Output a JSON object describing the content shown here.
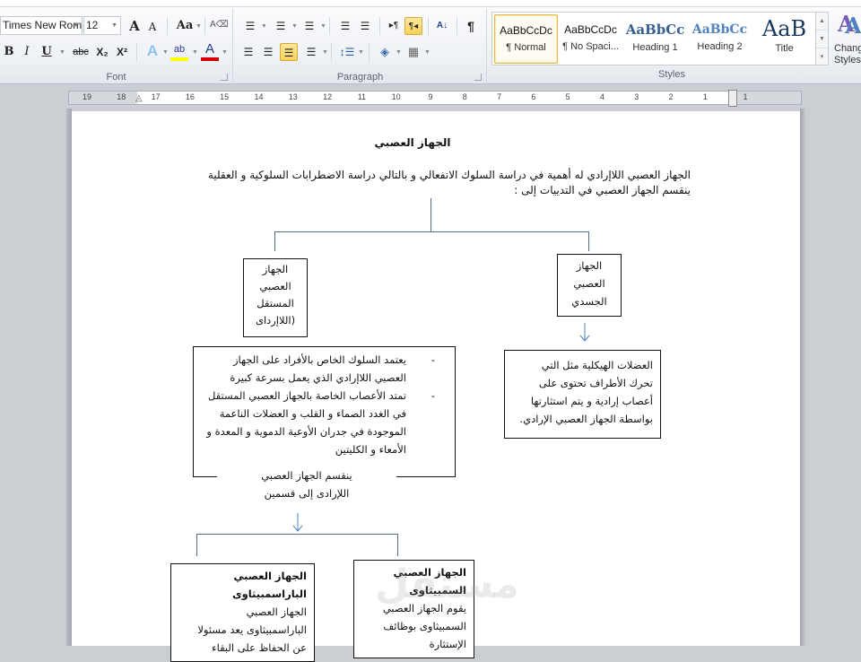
{
  "ribbon": {
    "font_group": {
      "label": "Font",
      "font_name": "Times New Rom",
      "font_size": "12",
      "grow_font": "A",
      "shrink_font": "A",
      "change_case": "Aa",
      "clear_format_icon": "clear-formatting",
      "bold": "B",
      "italic": "I",
      "underline": "U",
      "strikethrough": "abc",
      "subscript": "X₂",
      "superscript": "X²",
      "text_effects": "A",
      "highlight": "ab",
      "font_color": "A"
    },
    "paragraph_group": {
      "label": "Paragraph",
      "bullets": "☷",
      "numbering": "☷",
      "multilevel": "☷",
      "decrease_indent": "☰",
      "increase_indent": "☰",
      "ltr": "▸¶",
      "rtl": "¶◂",
      "sort": "A↓Z",
      "show_marks": "¶",
      "align_left": "☰",
      "center": "☰",
      "align_right": "☰",
      "justify": "☰",
      "line_spacing": "↕☰",
      "shading": "◈",
      "borders": "▦"
    },
    "styles_group": {
      "label": "Styles",
      "items": [
        {
          "preview": "AaBbCcDc",
          "name": "¶ Normal",
          "selected": true
        },
        {
          "preview": "AaBbCcDc",
          "name": "¶ No Spaci...",
          "selected": false
        },
        {
          "preview": "AaBbCc",
          "name": "Heading 1",
          "selected": false
        },
        {
          "preview": "AaBbCc",
          "name": "Heading 2",
          "selected": false
        },
        {
          "preview": "AaB",
          "name": "Title",
          "selected": false
        }
      ],
      "change_styles": "Change Styles",
      "change_styles_line1": "Chang",
      "change_styles_line2": "Styles"
    },
    "accent_colors": {
      "active_button": "#f9d25a",
      "highlight_bar": "#ffff00",
      "font_color_bar": "#d40000",
      "connector": "#4f6e8a"
    }
  },
  "ruler": {
    "numbers": [
      "19",
      "18",
      "17",
      "16",
      "15",
      "14",
      "13",
      "12",
      "11",
      "10",
      "9",
      "8",
      "7",
      "6",
      "5",
      "4",
      "3",
      "2",
      "1",
      "1"
    ]
  },
  "document": {
    "title": "الجهاز العصبي",
    "intro_line1": "الجهاز العصبي اللاإرادي له أهمية في دراسة السلوك الانفعالي و بالتالي دراسة الاضطرابات السلوكية و العقلية",
    "intro_line2": "ينقسم الجهاز العصبي في التدييات إلى :",
    "somatic_box": {
      "lines": [
        "الجهاز",
        "العصبي",
        "الجسدي"
      ]
    },
    "autonomic_box": {
      "lines": [
        "الجهاز",
        "العصبي",
        "المستقل",
        "(اللاإرداى"
      ]
    },
    "somatic_desc": {
      "lines": [
        "العضلات الهيكلية مثل التي",
        "تحرك الأطراف تحتوى على",
        "أعصاب إرادية و يتم استثارتها",
        "بواسطة الجهاز العصبي الإرادي."
      ]
    },
    "autonomic_desc": {
      "bullet_marker": "-",
      "bullets": [
        {
          "lines": [
            "يعتمد السلوك الخاص بالأفراد على الجهاز",
            "العصبي اللاإرادي الذي يعمل بسرعة كبيرة"
          ]
        },
        {
          "lines": [
            "تمتد الأعصاب الخاصة بالجهاز العصبي المستقل",
            "في الغدد الصماء و القلب و العضلات الناعمة",
            "الموجودة في جدران الأوعية الدموية و المعدة و",
            "الأمعاء و الكليتين"
          ]
        }
      ],
      "footer_line1": "ينقسم الجهاز العصبي",
      "footer_line2": "اللإرادى إلى قسمين"
    },
    "sympathetic_box": {
      "heading1": "الجهاز العصبي",
      "heading2": "السمبيثاوى",
      "lines": [
        "يقوم الجهاز العصبي",
        "السمبيثاوى بوظائف",
        "الإستثارة"
      ]
    },
    "parasympathetic_box": {
      "heading1": "الجهاز العصبي",
      "heading2": "الباراسمبيثاوى",
      "lines": [
        "الجهاز العصبي",
        "الباراسمبيثاوى يعد مسئولا",
        "عن الحفاظ على البقاء"
      ]
    },
    "watermark": "مستقل"
  }
}
